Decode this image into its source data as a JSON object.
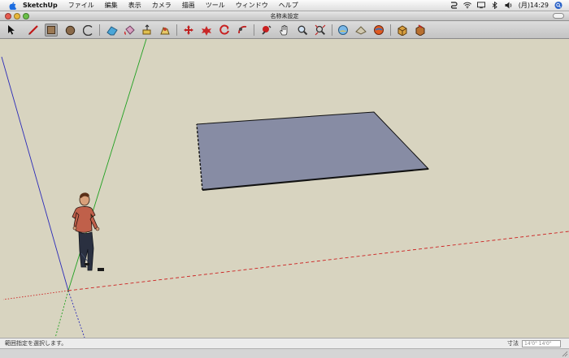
{
  "menubar": {
    "app_name": "SketchUp",
    "items": [
      "ファイル",
      "編集",
      "表示",
      "カメラ",
      "描画",
      "ツール",
      "ウィンドウ",
      "ヘルプ"
    ],
    "clock": "(月)14:29",
    "status_icons": [
      "scripts-icon",
      "wifi-icon",
      "display-icon",
      "bluetooth-icon",
      "volume-icon",
      "spotlight-icon"
    ]
  },
  "window": {
    "title": "名称未設定"
  },
  "toolbar": {
    "tools": [
      "select",
      "line",
      "rectangle",
      "circle",
      "arc",
      "eraser",
      "paint-bucket",
      "push-pull",
      "follow-me",
      "move",
      "rotate",
      "offset",
      "orbit",
      "pan",
      "zoom",
      "zoom-extents",
      "previous-view",
      "sandbox",
      "get-models",
      "section-plane",
      "components",
      "styles"
    ],
    "active_tool": "rectangle"
  },
  "viewport": {
    "background_color": "#d8d4c0",
    "axes_colors": {
      "red": "#cc2020",
      "green": "#20a020",
      "blue": "#2020c8"
    },
    "face_color": "#878ca4",
    "figure": "scale-figure-person"
  },
  "statusbar": {
    "message": "範囲指定を選択します。",
    "measurement_label": "寸法",
    "measurement_value": "14'0\" 14'0\""
  }
}
